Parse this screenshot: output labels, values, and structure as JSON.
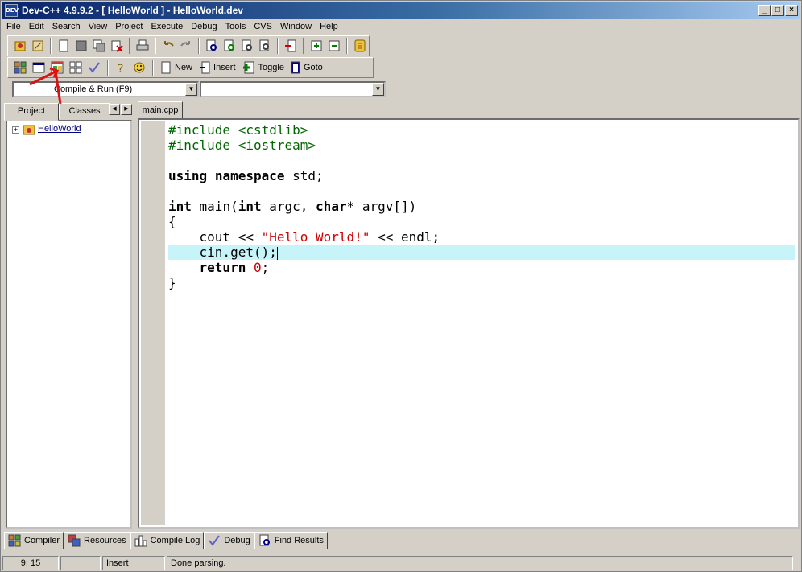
{
  "window": {
    "title": "Dev-C++ 4.9.9.2 - [ HelloWorld ] - HelloWorld.dev",
    "app_icon_text": "DEV",
    "controls": [
      "minimize",
      "maximize",
      "close"
    ]
  },
  "menu": [
    "File",
    "Edit",
    "Search",
    "View",
    "Project",
    "Execute",
    "Debug",
    "Tools",
    "CVS",
    "Window",
    "Help"
  ],
  "toolbar_secondary": {
    "new_label": "New",
    "insert_label": "Insert",
    "toggle_label": "Toggle",
    "goto_label": "Goto"
  },
  "compile_combo": {
    "value": "Compile & Run (F9)"
  },
  "class_combo": {
    "value": ""
  },
  "left_panel": {
    "tabs": [
      "Project",
      "Classes"
    ],
    "active_tab": "Project",
    "tree_root": "HelloWorld"
  },
  "editor": {
    "file_tab": "main.cpp",
    "highlighted_line": 9,
    "lines": [
      "#include <cstdlib>",
      "#include <iostream>",
      "",
      "using namespace std;",
      "",
      "int main(int argc, char* argv[])",
      "{",
      "    cout << \"Hello World!\" << endl;",
      "    cin.get();",
      "    return 0;",
      "}"
    ]
  },
  "bottom_tabs": [
    "Compiler",
    "Resources",
    "Compile Log",
    "Debug",
    "Find Results"
  ],
  "status": {
    "position": "9: 15",
    "modified": "",
    "mode": "Insert",
    "message": "Done parsing."
  },
  "colors": {
    "title_gradient_start": "#0a246a",
    "title_gradient_end": "#a6caf0",
    "preprocessor": "#006600",
    "string": "#cc0000",
    "current_line": "#c6f4f8",
    "annotation_arrow": "#dd1111"
  }
}
